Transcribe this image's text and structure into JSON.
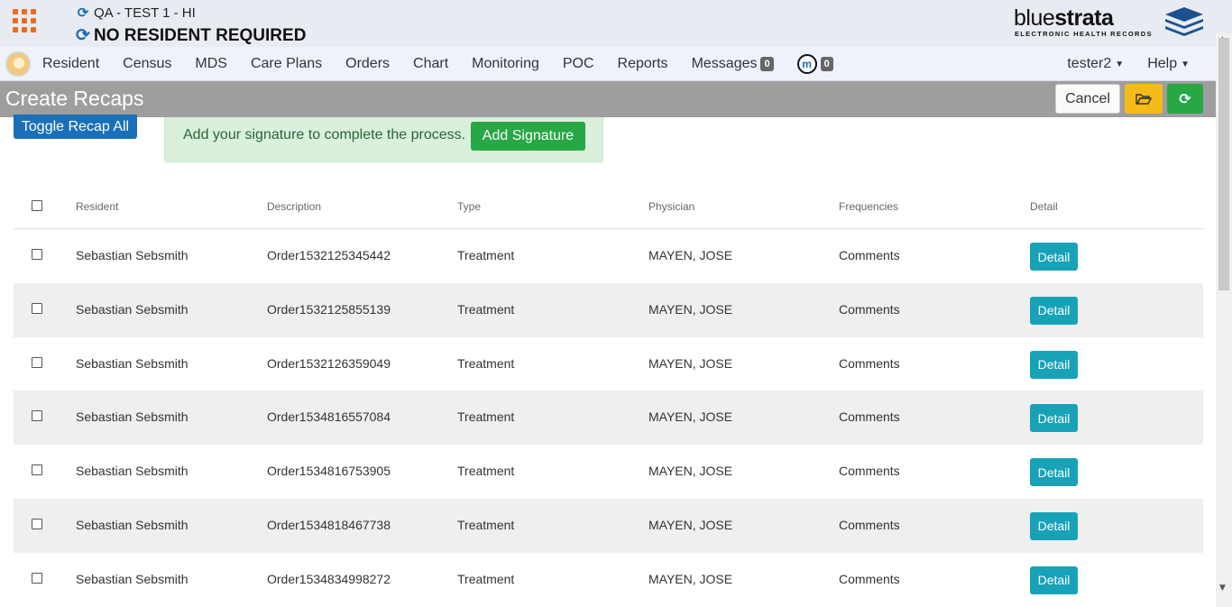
{
  "header": {
    "facility": "QA - TEST 1 - HI",
    "resident": "NO RESIDENT REQUIRED",
    "logo_light": "blue",
    "logo_bold": "strata",
    "logo_sub": "ELECTRONIC HEALTH RECORDS",
    "brand_color": "#f06a1d"
  },
  "nav": {
    "items": [
      "Resident",
      "Census",
      "MDS",
      "Care Plans",
      "Orders",
      "Chart",
      "Monitoring",
      "POC",
      "Reports"
    ],
    "messages_label": "Messages",
    "messages_count": "0",
    "m_count": "0",
    "user": "tester2",
    "help": "Help"
  },
  "titlebar": {
    "title": "Create Recaps",
    "cancel": "Cancel"
  },
  "toggle_label": "Toggle Recap All",
  "signature": {
    "text": "Add your signature to complete the process.",
    "button": "Add Signature"
  },
  "table": {
    "headers": [
      "Resident",
      "Description",
      "Type",
      "Physician",
      "Frequencies",
      "Detail"
    ],
    "detail_label": "Detail",
    "rows": [
      {
        "resident": "Sebastian Sebsmith",
        "description": "Order1532125345442",
        "type": "Treatment",
        "physician": "MAYEN, JOSE",
        "frequencies": "Comments"
      },
      {
        "resident": "Sebastian Sebsmith",
        "description": "Order1532125855139",
        "type": "Treatment",
        "physician": "MAYEN, JOSE",
        "frequencies": "Comments"
      },
      {
        "resident": "Sebastian Sebsmith",
        "description": "Order1532126359049",
        "type": "Treatment",
        "physician": "MAYEN, JOSE",
        "frequencies": "Comments"
      },
      {
        "resident": "Sebastian Sebsmith",
        "description": "Order1534816557084",
        "type": "Treatment",
        "physician": "MAYEN, JOSE",
        "frequencies": "Comments"
      },
      {
        "resident": "Sebastian Sebsmith",
        "description": "Order1534816753905",
        "type": "Treatment",
        "physician": "MAYEN, JOSE",
        "frequencies": "Comments"
      },
      {
        "resident": "Sebastian Sebsmith",
        "description": "Order1534818467738",
        "type": "Treatment",
        "physician": "MAYEN, JOSE",
        "frequencies": "Comments"
      },
      {
        "resident": "Sebastian Sebsmith",
        "description": "Order1534834998272",
        "type": "Treatment",
        "physician": "MAYEN, JOSE",
        "frequencies": "Comments"
      }
    ]
  }
}
